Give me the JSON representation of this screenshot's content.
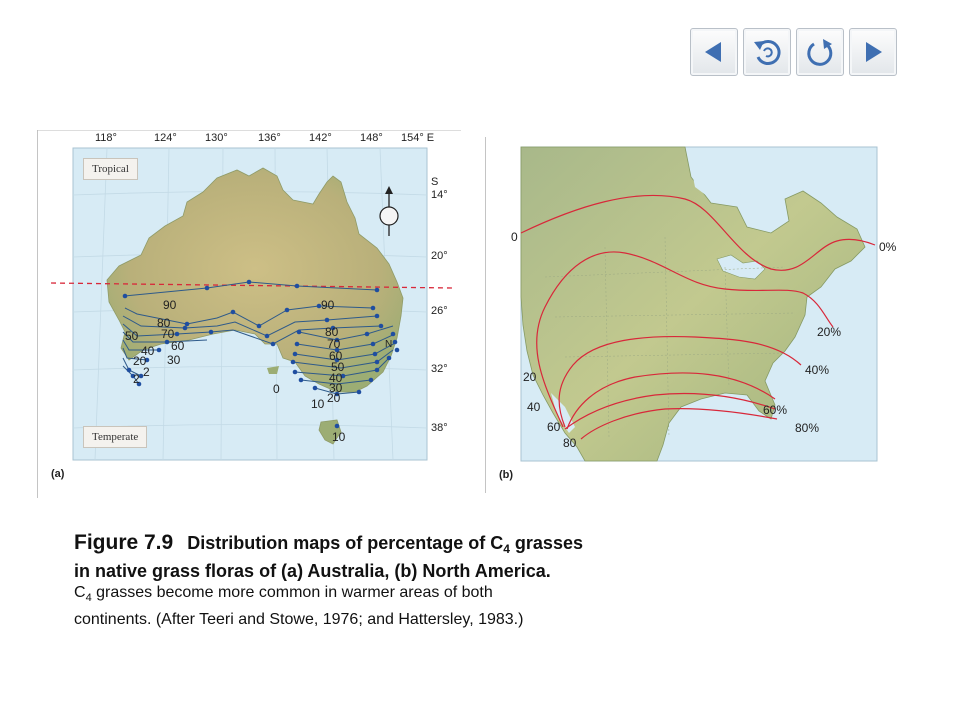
{
  "navigation": {
    "prev_icon": "triangle-left-icon",
    "return_icon": "return-icon",
    "replay_icon": "replay-icon",
    "next_icon": "triangle-right-icon"
  },
  "map_a": {
    "panel_label": "(a)",
    "longitude_ticks": [
      "118°",
      "124°",
      "130°",
      "136°",
      "142°",
      "148°",
      "154° E"
    ],
    "latitude_ticks": [
      "S\n14°",
      "20°",
      "26°",
      "32°",
      "38°"
    ],
    "regions": [
      "Tropical",
      "Temperate"
    ],
    "compass": "N",
    "isoline_labels": {
      "west": [
        "90",
        "80",
        "70",
        "60",
        "50",
        "40",
        "30",
        "20",
        "2",
        "2"
      ],
      "east": [
        "90",
        "80",
        "70",
        "60",
        "50",
        "40",
        "30",
        "20",
        "10",
        "0",
        "10"
      ]
    }
  },
  "map_b": {
    "panel_label": "(b)",
    "isoline_labels_left": [
      "0",
      "20",
      "40",
      "60",
      "80"
    ],
    "isoline_labels_right": [
      "0%",
      "20%",
      "40%",
      "60%",
      "80%"
    ]
  },
  "caption": {
    "figure_number": "Figure 7.9",
    "title_line1": "Distribution maps of percentage of C",
    "title_sub": "4",
    "title_line1_end": " grasses",
    "title_line2": "in native grass floras of (a) Australia, (b) North America.",
    "body_line1_start": "C",
    "body_sub": "4",
    "body_line1_end": " grasses become more common in warmer areas of both",
    "body_line2": "continents. (After Teeri and Stowe, 1976; and Hattersley, 1983.)"
  },
  "colors": {
    "ocean": "#d8ecf6",
    "land": "#c9b97e",
    "isoline_a": "#2e5a8a",
    "dots_a": "#1f4ea0",
    "isoline_b": "#d8283a",
    "tropic_line": "#d8283a"
  }
}
